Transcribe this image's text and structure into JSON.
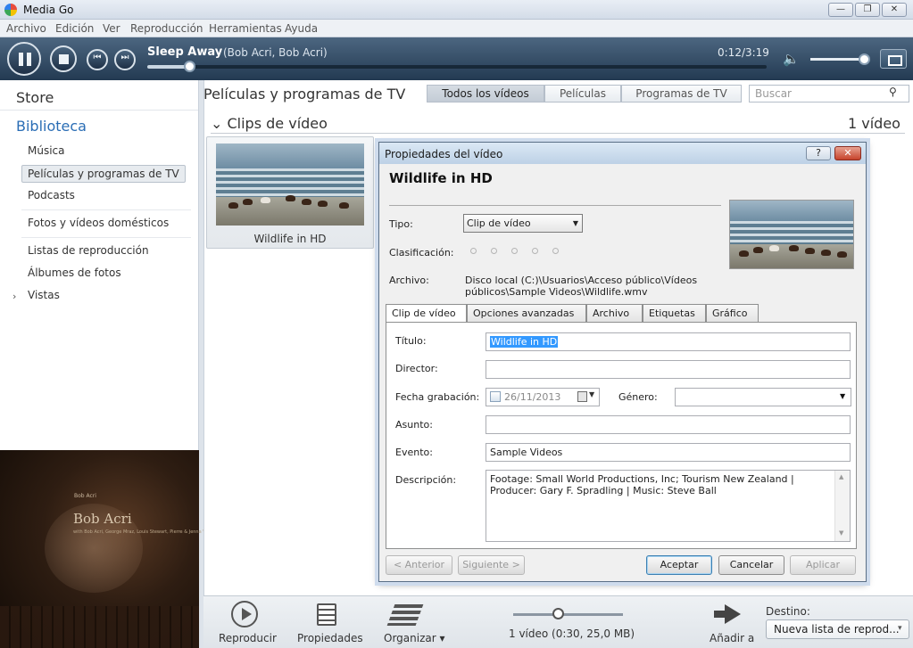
{
  "window": {
    "title": "Media Go",
    "min_glyph": "—",
    "max_glyph": "❐",
    "close_glyph": "✕"
  },
  "menu": [
    "Archivo",
    "Edición",
    "Ver",
    "Reproducción",
    "Herramientas",
    "Ayuda"
  ],
  "player": {
    "track_title": "Sleep Away",
    "track_artist": "(Bob Acri, Bob Acri)",
    "time": "0:12/3:19",
    "progress_fraction": 0.068,
    "volume_fraction": 0.93,
    "prev_glyph": "⏮",
    "next_glyph": "⏭",
    "volume_glyph": "🔈"
  },
  "sidebar": {
    "store": "Store",
    "library": "Biblioteca",
    "items": [
      "Música",
      "Películas y programas de TV",
      "Podcasts",
      "Fotos y vídeos domésticos",
      "Listas de reproducción",
      "Álbumes de fotos",
      "Vistas"
    ],
    "vistas_arrow": "›"
  },
  "album_art": {
    "small_text": "Bob Acri",
    "artist": "Bob Acri",
    "line": "with Bob Acri, George Mraz, Louis Stewart, Pierre & Jenna Walsh"
  },
  "main": {
    "title": "Películas y programas de TV",
    "tabs": [
      "Todos los vídeos",
      "Películas",
      "Programas de TV"
    ],
    "search_placeholder": "Buscar",
    "search_icon": "⚲",
    "section_title": "⌄ Clips de vídeo",
    "section_count": "1 vídeo",
    "video_item": "Wildlife in HD"
  },
  "bottom_toolbar": {
    "play_label": "Reproducir",
    "properties_label": "Propiedades",
    "organize_label": "Organizar ▾",
    "summary": "1 vídeo (0:30, 25,0 MB)",
    "zoom_fraction": 0.41,
    "add_label": "Añadir a",
    "destination_label": "Destino:",
    "destination_value": "Nueva lista de reprod...",
    "dropdown_glyph": "▾"
  },
  "dialog": {
    "title": "Propiedades del vídeo",
    "help_glyph": "?",
    "close_glyph": "✕",
    "heading": "Wildlife in HD",
    "type_label": "Tipo:",
    "type_value": "Clip de vídeo",
    "rating_label": "Clasificación:",
    "rating_stars": 0,
    "file_label": "Archivo:",
    "file_path": "Disco local (C:)\\Usuarios\\Acceso público\\Vídeos públicos\\Sample Videos\\Wildlife.wmv",
    "tabs": [
      "Clip de vídeo",
      "Opciones avanzadas",
      "Archivo",
      "Etiquetas",
      "Gráfico"
    ],
    "fields": {
      "title_label": "Título:",
      "title_value": "Wildlife in HD",
      "director_label": "Director:",
      "director_value": "",
      "date_label": "Fecha grabación:",
      "date_value": "26/11/2013",
      "genre_label": "Género:",
      "genre_value": "",
      "subject_label": "Asunto:",
      "subject_value": "",
      "event_label": "Evento:",
      "event_value": "Sample Videos",
      "description_label": "Descripción:",
      "description_value": "Footage: Small World Productions, Inc; Tourism New Zealand | Producer: Gary F. Spradling | Music: Steve Ball"
    },
    "buttons": {
      "prev": "< Anterior",
      "next": "Siguiente >",
      "accept": "Aceptar",
      "cancel": "Cancelar",
      "apply": "Aplicar"
    }
  }
}
